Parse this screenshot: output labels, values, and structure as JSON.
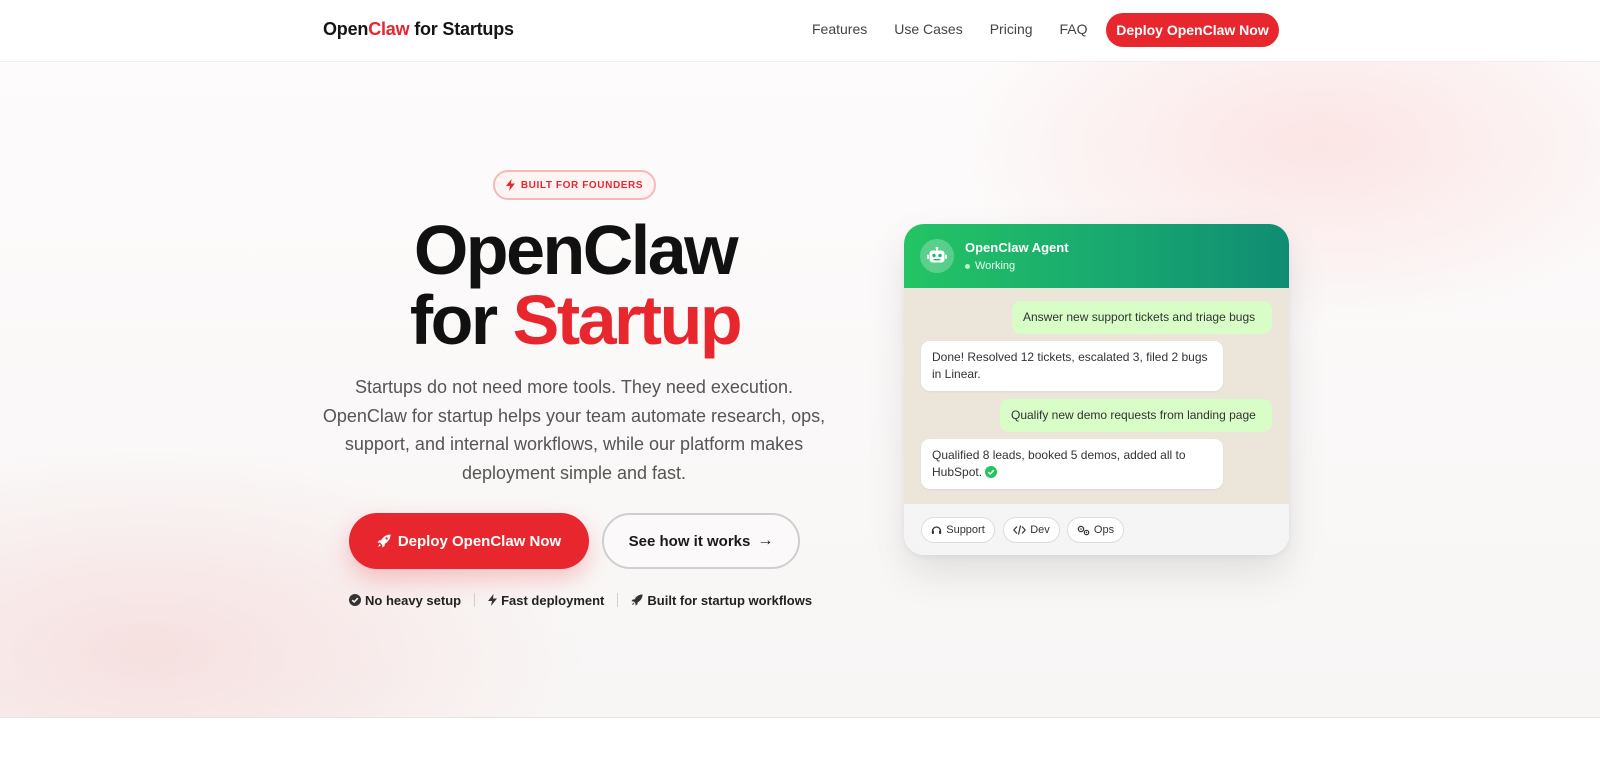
{
  "nav": {
    "logo": {
      "part1": "Open",
      "part2": "Claw",
      "part3": " for Startups"
    },
    "links": [
      "Features",
      "Use Cases",
      "Pricing",
      "FAQ"
    ],
    "cta_label": "Deploy OpenClaw Now"
  },
  "hero": {
    "badge": "BUILT FOR FOUNDERS",
    "title_line1": "OpenClaw",
    "title_line2_prefix": "for ",
    "title_line2_accent": "Startup",
    "description": "Startups do not need more tools. They need execution. OpenClaw for startup helps your team automate research, ops, support, and internal workflows, while our platform makes deployment simple and fast.",
    "primary_cta": "Deploy OpenClaw Now",
    "secondary_cta": "See how it works",
    "secondary_arrow": "→",
    "features": [
      "No heavy setup",
      "Fast deployment",
      "Built for startup workflows"
    ]
  },
  "chat": {
    "agent_name": "OpenClaw Agent",
    "status": "Working",
    "messages": [
      {
        "from": "user",
        "text": "Answer new support tickets and triage bugs"
      },
      {
        "from": "agent",
        "text": "Done! Resolved 12 tickets, escalated 3, filed 2 bugs in Linear."
      },
      {
        "from": "user",
        "text": "Qualify new demo requests from landing page"
      },
      {
        "from": "agent",
        "text": "Qualified 8 leads, booked 5 demos, added all to HubSpot."
      }
    ],
    "chips": [
      "Support",
      "Dev",
      "Ops"
    ]
  },
  "icons": [
    "bolt-icon",
    "rocket-icon",
    "arrow-right-icon",
    "check-circle-icon",
    "robot-icon",
    "headset-icon",
    "code-icon",
    "gears-icon"
  ],
  "colors": {
    "brand_red": "#e8262d",
    "chat_green": "#1fb86a",
    "bubble_out": "#d8fdc6",
    "chat_bg": "#ece5da"
  }
}
